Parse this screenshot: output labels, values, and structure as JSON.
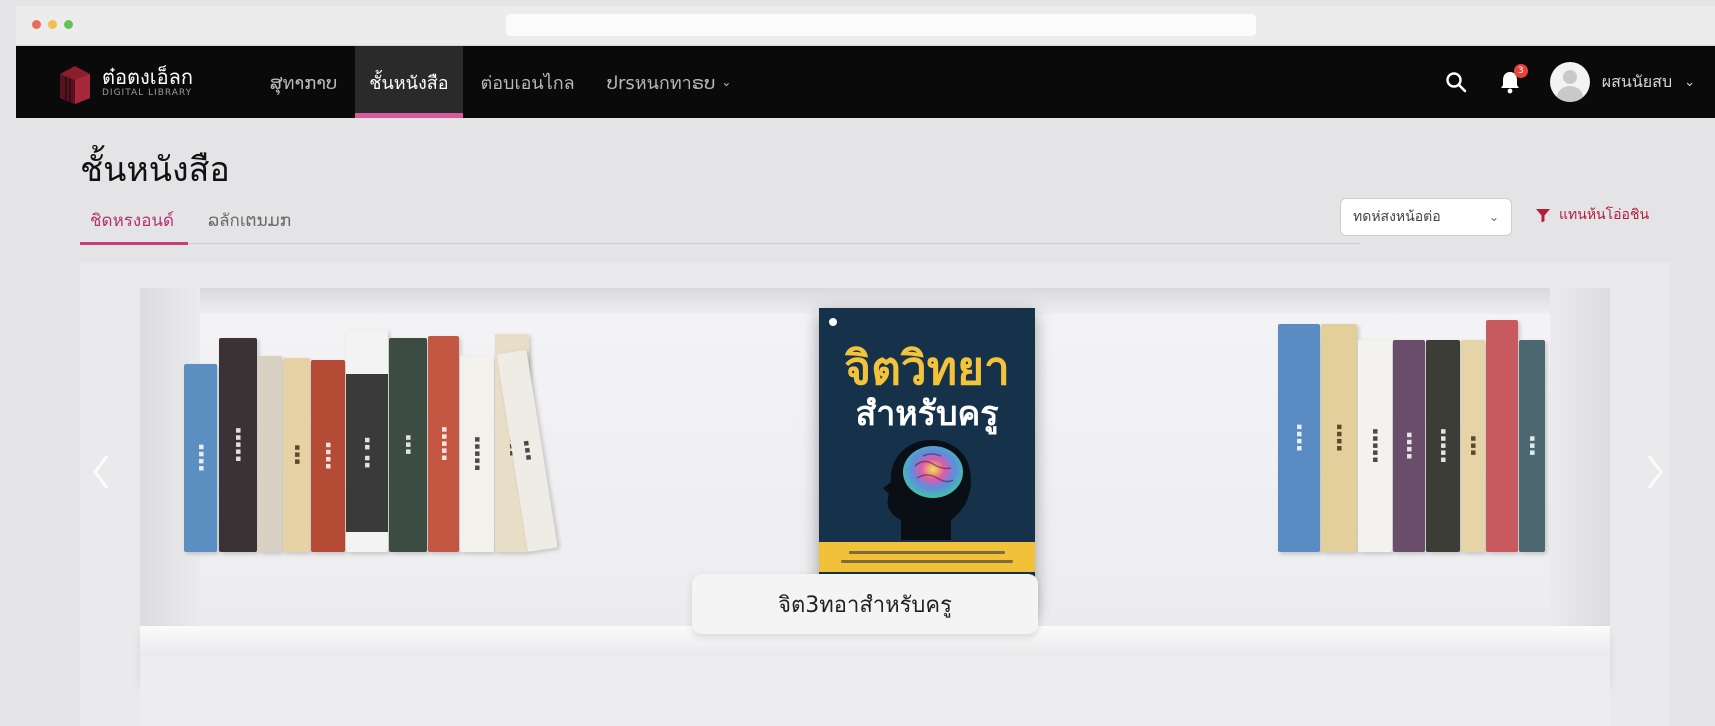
{
  "browser": {
    "dots": [
      "#ec6a5e",
      "#f4bf4f",
      "#61c554"
    ]
  },
  "app": {
    "logo_title": "ต๋อตงเอ็ลก",
    "logo_subtitle": "DIGITAL LIBRARY"
  },
  "nav": {
    "items": [
      {
        "label": "ສຸทາກາບ",
        "active": false
      },
      {
        "label": "ชั้นหนังสือ",
        "active": true
      },
      {
        "label": "ต่อบเอนไกล",
        "active": false
      },
      {
        "label": "ປrsหนกทาຣບ",
        "active": false,
        "has_dropdown": true
      }
    ],
    "notification_count": "3",
    "user_name": "ผสนนัยสบ"
  },
  "page": {
    "title": "ชั้นหนังสือ",
    "tabs": [
      {
        "label": "ชิดหรงอนด์",
        "active": true
      },
      {
        "label": "ລลักเຕນມກ",
        "active": false
      }
    ],
    "sort_label": "ทดห่สงหน้อต่อ",
    "filter_label": "แทนห้นโอ่อชิน"
  },
  "shelf": {
    "featured_book": {
      "title_line1": "จิตวิทยา",
      "title_line2": "สำหรับครู",
      "caption": "จิต3ทอาสำหรับครู"
    },
    "left_books": [
      {
        "color": "#5b8fc1"
      },
      {
        "color": "#3b3236"
      },
      {
        "color": "#d9d2c4"
      },
      {
        "color": "#e6d2a4"
      },
      {
        "color": "#b54a35"
      },
      {
        "color": "#3a3a3a"
      },
      {
        "color": "#3d4c42"
      },
      {
        "color": "#c45742"
      },
      {
        "color": "#f3f1ec"
      },
      {
        "color": "#e8ddc7"
      },
      {
        "color": "#efece6"
      }
    ],
    "right_books": [
      {
        "color": "#5a8cc3"
      },
      {
        "color": "#e2cf9c"
      },
      {
        "color": "#f4f2ee"
      },
      {
        "color": "#6a4d6b"
      },
      {
        "color": "#3b3d36"
      },
      {
        "color": "#e5d4a7"
      },
      {
        "color": "#c85a5f"
      },
      {
        "color": "#4b6870"
      }
    ]
  }
}
